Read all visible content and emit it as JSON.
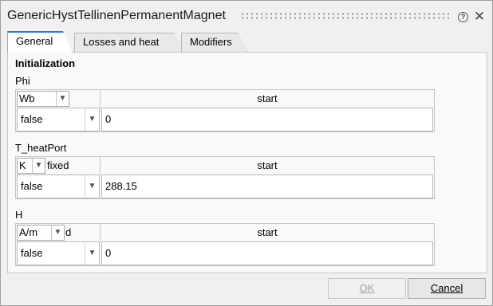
{
  "dialog": {
    "title": "GenericHystTellinenPermanentMagnet",
    "help_glyph": "?",
    "close_glyph": "✕",
    "icons": [
      "grip-icon",
      "help-icon",
      "close-icon"
    ]
  },
  "tabs": [
    {
      "label": "General",
      "active": true
    },
    {
      "label": "Losses and heat",
      "active": false
    },
    {
      "label": "Modifiers",
      "active": false
    }
  ],
  "section": {
    "heading": "Initialization"
  },
  "params": [
    {
      "label": "Phi",
      "unit": "Wb",
      "unit_tail": "",
      "fixed_label": "",
      "start_header": "start",
      "fixed_value": "false",
      "start_value": "0"
    },
    {
      "label": "T_heatPort",
      "unit": "K",
      "unit_tail": "",
      "fixed_label": "fixed",
      "start_header": "start",
      "fixed_value": "false",
      "start_value": "288.15"
    },
    {
      "label": "H",
      "unit": "A/m",
      "unit_tail": "d",
      "fixed_label": "",
      "start_header": "start",
      "fixed_value": "false",
      "start_value": "0"
    }
  ],
  "buttons": {
    "ok_label": "OK",
    "cancel_label": "Cancel"
  }
}
